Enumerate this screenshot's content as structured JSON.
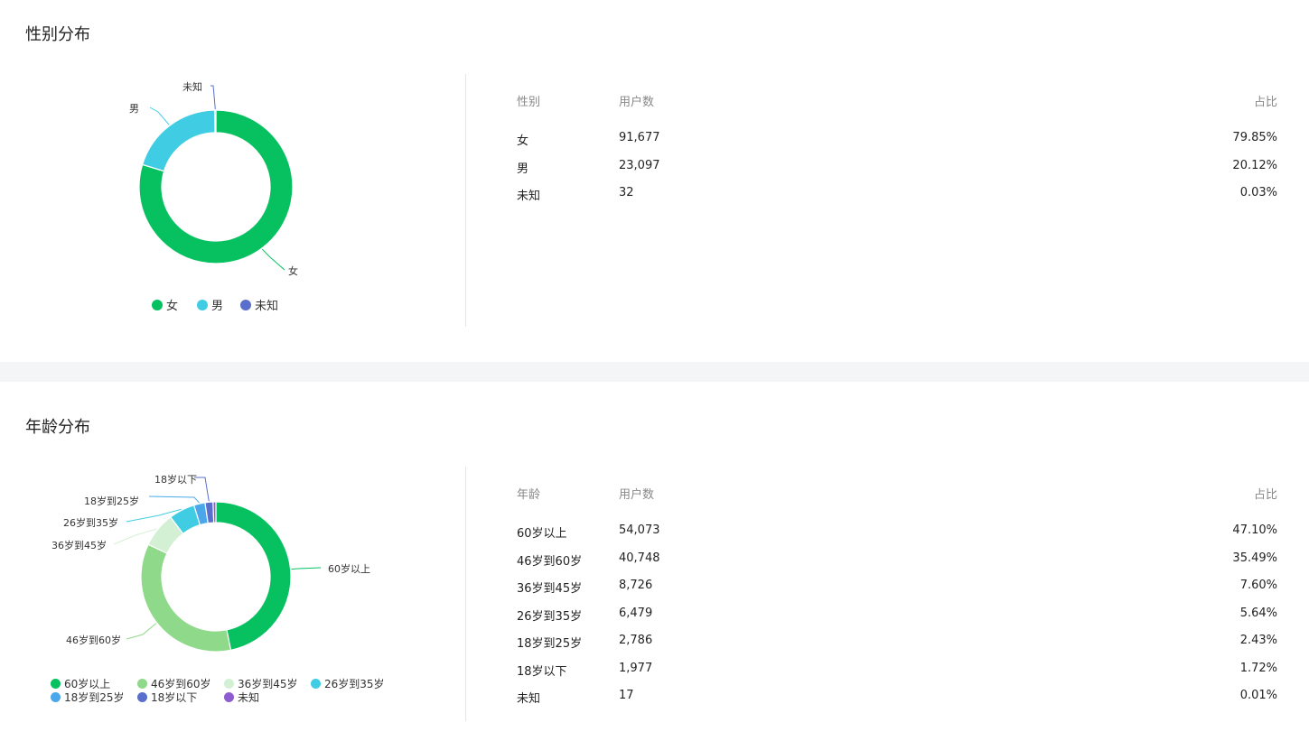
{
  "gender": {
    "title": "性别分布",
    "table": {
      "headers": [
        "性别",
        "用户数",
        "占比"
      ],
      "rows": [
        {
          "label": "女",
          "count": "91,677",
          "pct": "79.85%"
        },
        {
          "label": "男",
          "count": "23,097",
          "pct": "20.12%"
        },
        {
          "label": "未知",
          "count": "32",
          "pct": "0.03%"
        }
      ]
    }
  },
  "age": {
    "title": "年龄分布",
    "table": {
      "headers": [
        "年龄",
        "用户数",
        "占比"
      ],
      "rows": [
        {
          "label": "60岁以上",
          "count": "54,073",
          "pct": "47.10%"
        },
        {
          "label": "46岁到60岁",
          "count": "40,748",
          "pct": "35.49%"
        },
        {
          "label": "36岁到45岁",
          "count": "8,726",
          "pct": "7.60%"
        },
        {
          "label": "26岁到35岁",
          "count": "6,479",
          "pct": "5.64%"
        },
        {
          "label": "18岁到25岁",
          "count": "2,786",
          "pct": "2.43%"
        },
        {
          "label": "18岁以下",
          "count": "1,977",
          "pct": "1.72%"
        },
        {
          "label": "未知",
          "count": "17",
          "pct": "0.01%"
        }
      ]
    }
  },
  "chart_data": [
    {
      "type": "pie",
      "title": "性别分布",
      "categories": [
        "女",
        "男",
        "未知"
      ],
      "values": [
        91677,
        23097,
        32
      ],
      "colors": [
        "#07c160",
        "#40cde3",
        "#5a6fcc"
      ],
      "legend": "bottom"
    },
    {
      "type": "pie",
      "title": "年龄分布",
      "categories": [
        "60岁以上",
        "46岁到60岁",
        "36岁到45岁",
        "26岁到35岁",
        "18岁到25岁",
        "18岁以下",
        "未知"
      ],
      "values": [
        54073,
        40748,
        8726,
        6479,
        2786,
        1977,
        17
      ],
      "colors": [
        "#07c160",
        "#8fd98b",
        "#d3f0d4",
        "#40cde3",
        "#4aa8ea",
        "#5a6fcc",
        "#8f5ccf"
      ],
      "legend": "bottom"
    }
  ]
}
